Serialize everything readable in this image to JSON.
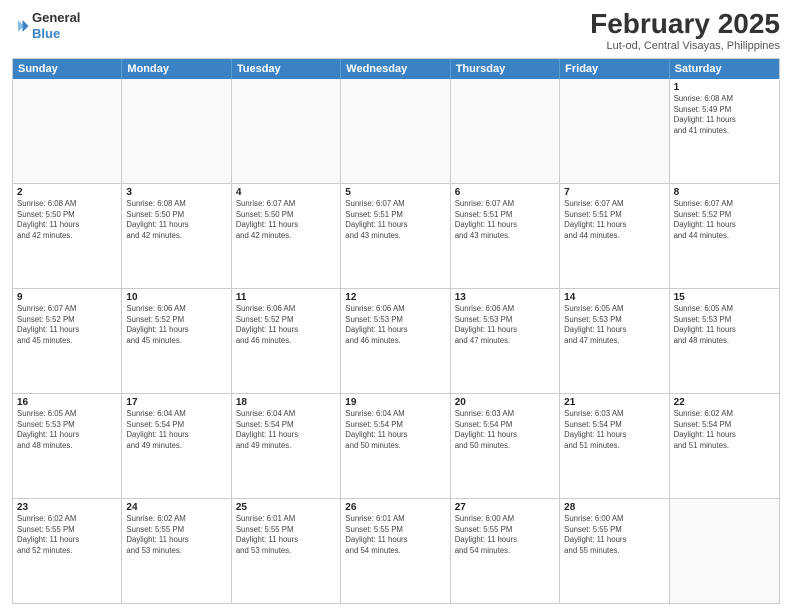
{
  "header": {
    "logo_line1": "General",
    "logo_line2": "Blue",
    "month_year": "February 2025",
    "location": "Lut-od, Central Visayas, Philippines"
  },
  "day_headers": [
    "Sunday",
    "Monday",
    "Tuesday",
    "Wednesday",
    "Thursday",
    "Friday",
    "Saturday"
  ],
  "weeks": [
    [
      {
        "day": "",
        "info": ""
      },
      {
        "day": "",
        "info": ""
      },
      {
        "day": "",
        "info": ""
      },
      {
        "day": "",
        "info": ""
      },
      {
        "day": "",
        "info": ""
      },
      {
        "day": "",
        "info": ""
      },
      {
        "day": "1",
        "info": "Sunrise: 6:08 AM\nSunset: 5:49 PM\nDaylight: 11 hours\nand 41 minutes."
      }
    ],
    [
      {
        "day": "2",
        "info": "Sunrise: 6:08 AM\nSunset: 5:50 PM\nDaylight: 11 hours\nand 42 minutes."
      },
      {
        "day": "3",
        "info": "Sunrise: 6:08 AM\nSunset: 5:50 PM\nDaylight: 11 hours\nand 42 minutes."
      },
      {
        "day": "4",
        "info": "Sunrise: 6:07 AM\nSunset: 5:50 PM\nDaylight: 11 hours\nand 42 minutes."
      },
      {
        "day": "5",
        "info": "Sunrise: 6:07 AM\nSunset: 5:51 PM\nDaylight: 11 hours\nand 43 minutes."
      },
      {
        "day": "6",
        "info": "Sunrise: 6:07 AM\nSunset: 5:51 PM\nDaylight: 11 hours\nand 43 minutes."
      },
      {
        "day": "7",
        "info": "Sunrise: 6:07 AM\nSunset: 5:51 PM\nDaylight: 11 hours\nand 44 minutes."
      },
      {
        "day": "8",
        "info": "Sunrise: 6:07 AM\nSunset: 5:52 PM\nDaylight: 11 hours\nand 44 minutes."
      }
    ],
    [
      {
        "day": "9",
        "info": "Sunrise: 6:07 AM\nSunset: 5:52 PM\nDaylight: 11 hours\nand 45 minutes."
      },
      {
        "day": "10",
        "info": "Sunrise: 6:06 AM\nSunset: 5:52 PM\nDaylight: 11 hours\nand 45 minutes."
      },
      {
        "day": "11",
        "info": "Sunrise: 6:06 AM\nSunset: 5:52 PM\nDaylight: 11 hours\nand 46 minutes."
      },
      {
        "day": "12",
        "info": "Sunrise: 6:06 AM\nSunset: 5:53 PM\nDaylight: 11 hours\nand 46 minutes."
      },
      {
        "day": "13",
        "info": "Sunrise: 6:06 AM\nSunset: 5:53 PM\nDaylight: 11 hours\nand 47 minutes."
      },
      {
        "day": "14",
        "info": "Sunrise: 6:05 AM\nSunset: 5:53 PM\nDaylight: 11 hours\nand 47 minutes."
      },
      {
        "day": "15",
        "info": "Sunrise: 6:05 AM\nSunset: 5:53 PM\nDaylight: 11 hours\nand 48 minutes."
      }
    ],
    [
      {
        "day": "16",
        "info": "Sunrise: 6:05 AM\nSunset: 5:53 PM\nDaylight: 11 hours\nand 48 minutes."
      },
      {
        "day": "17",
        "info": "Sunrise: 6:04 AM\nSunset: 5:54 PM\nDaylight: 11 hours\nand 49 minutes."
      },
      {
        "day": "18",
        "info": "Sunrise: 6:04 AM\nSunset: 5:54 PM\nDaylight: 11 hours\nand 49 minutes."
      },
      {
        "day": "19",
        "info": "Sunrise: 6:04 AM\nSunset: 5:54 PM\nDaylight: 11 hours\nand 50 minutes."
      },
      {
        "day": "20",
        "info": "Sunrise: 6:03 AM\nSunset: 5:54 PM\nDaylight: 11 hours\nand 50 minutes."
      },
      {
        "day": "21",
        "info": "Sunrise: 6:03 AM\nSunset: 5:54 PM\nDaylight: 11 hours\nand 51 minutes."
      },
      {
        "day": "22",
        "info": "Sunrise: 6:02 AM\nSunset: 5:54 PM\nDaylight: 11 hours\nand 51 minutes."
      }
    ],
    [
      {
        "day": "23",
        "info": "Sunrise: 6:02 AM\nSunset: 5:55 PM\nDaylight: 11 hours\nand 52 minutes."
      },
      {
        "day": "24",
        "info": "Sunrise: 6:02 AM\nSunset: 5:55 PM\nDaylight: 11 hours\nand 53 minutes."
      },
      {
        "day": "25",
        "info": "Sunrise: 6:01 AM\nSunset: 5:55 PM\nDaylight: 11 hours\nand 53 minutes."
      },
      {
        "day": "26",
        "info": "Sunrise: 6:01 AM\nSunset: 5:55 PM\nDaylight: 11 hours\nand 54 minutes."
      },
      {
        "day": "27",
        "info": "Sunrise: 6:00 AM\nSunset: 5:55 PM\nDaylight: 11 hours\nand 54 minutes."
      },
      {
        "day": "28",
        "info": "Sunrise: 6:00 AM\nSunset: 5:55 PM\nDaylight: 11 hours\nand 55 minutes."
      },
      {
        "day": "",
        "info": ""
      }
    ]
  ]
}
